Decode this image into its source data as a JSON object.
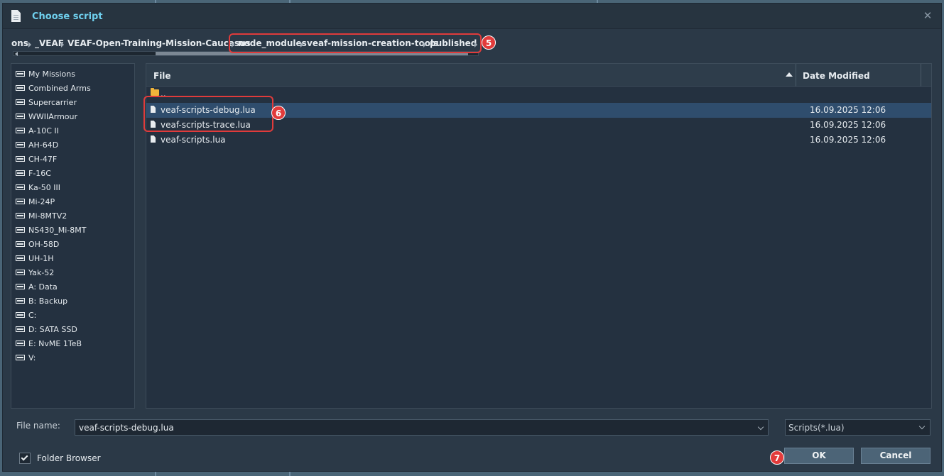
{
  "window": {
    "title": "Choose script",
    "icon": "document-icon"
  },
  "breadcrumb": {
    "items": [
      "ons",
      "_VEAF",
      "VEAF-Open-Training-Mission-Caucasus",
      "node_modules",
      "veaf-mission-creation-tools",
      "published"
    ]
  },
  "annotations": {
    "badge5": "5",
    "badge6": "6",
    "badge7": "7"
  },
  "sidebar": {
    "items": [
      {
        "label": "My Missions"
      },
      {
        "label": "Combined Arms"
      },
      {
        "label": "Supercarrier"
      },
      {
        "label": "WWIIArmour"
      },
      {
        "label": "A-10C II"
      },
      {
        "label": "AH-64D"
      },
      {
        "label": "CH-47F"
      },
      {
        "label": "F-16C"
      },
      {
        "label": "Ka-50 III"
      },
      {
        "label": "Mi-24P"
      },
      {
        "label": "Mi-8MTV2"
      },
      {
        "label": "NS430_Mi-8MT"
      },
      {
        "label": "OH-58D"
      },
      {
        "label": "UH-1H"
      },
      {
        "label": "Yak-52"
      },
      {
        "label": "A: Data"
      },
      {
        "label": "B: Backup"
      },
      {
        "label": "C:"
      },
      {
        "label": "D: SATA SSD"
      },
      {
        "label": "E: NvME 1TeB"
      },
      {
        "label": "V:"
      }
    ]
  },
  "filelist": {
    "columns": {
      "file": "File",
      "date": "Date Modified"
    },
    "parent": "..",
    "rows": [
      {
        "name": "veaf-scripts-debug.lua",
        "date": "16.09.2025 12:06",
        "selected": true
      },
      {
        "name": "veaf-scripts-trace.lua",
        "date": "16.09.2025 12:06",
        "selected": false
      },
      {
        "name": "veaf-scripts.lua",
        "date": "16.09.2025 12:06",
        "selected": false
      }
    ]
  },
  "footer": {
    "filename_label": "File name:",
    "filename_value": "veaf-scripts-debug.lua",
    "filter_value": "Scripts(*.lua)",
    "folder_browser_label": "Folder Browser",
    "folder_browser_checked": true,
    "ok_label": "OK",
    "cancel_label": "Cancel"
  },
  "colors": {
    "accent_title": "#6fd0ee",
    "annotation": "#e23b3b",
    "selected_row": "#2f4d6d"
  }
}
